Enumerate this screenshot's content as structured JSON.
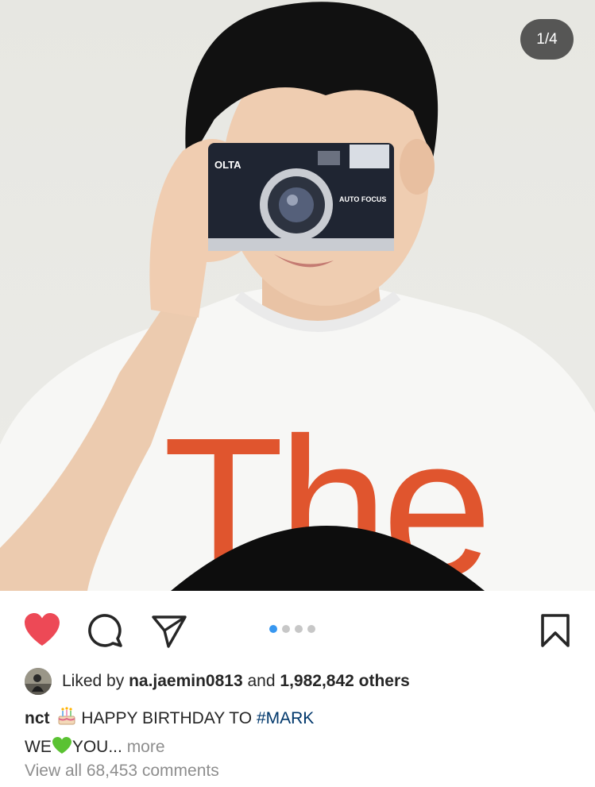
{
  "post": {
    "image_counter": "1/4",
    "carousel": {
      "total": 4,
      "active_index": 0
    },
    "liked": true,
    "saved": false
  },
  "likes": {
    "prefix": "Liked by",
    "user": "na.jaemin0813",
    "joiner": "and",
    "count": "1,982,842 others"
  },
  "caption": {
    "username": "nct",
    "emoji_cake": "birthday-cake-emoji",
    "text1": "HAPPY BIRTHDAY TO",
    "hashtag": "#MARK",
    "line2_a": "WE",
    "emoji_heart": "green-heart-emoji",
    "line2_b": "YOU...",
    "more": "more"
  },
  "comments": {
    "view_all": "View all 68,453 comments"
  },
  "photo": {
    "shirt_text": "The",
    "camera_brand": "OLTA",
    "camera_label": "AUTO FOCUS"
  },
  "colors": {
    "heart": "#ed4956",
    "dot_active": "#3897f0",
    "dot_inactive": "#c7c7c7",
    "hashtag": "#00376b",
    "muted": "#8e8e8e",
    "shirt_print": "#e0552e"
  }
}
